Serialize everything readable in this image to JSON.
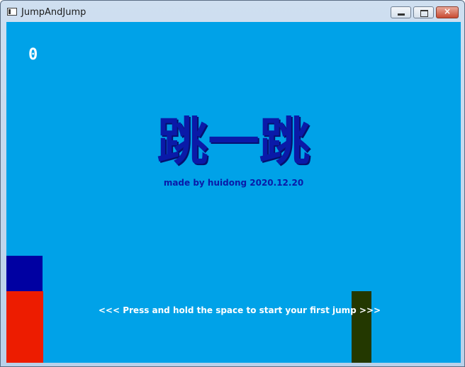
{
  "window": {
    "title": "JumpAndJump",
    "buttons": {
      "minimize": "minimize",
      "maximize": "maximize",
      "close": "×"
    }
  },
  "game": {
    "score": "0",
    "title": "跳一跳",
    "credit": "made by huidong 2020.12.20",
    "hint": "<<< Press and hold the space to start your first jump >>>",
    "colors": {
      "background": "#00a2e8",
      "player": "#0000a2",
      "platform_left": "#ed1c00",
      "platform_right": "#233800",
      "title": "#0a1aa8"
    }
  }
}
